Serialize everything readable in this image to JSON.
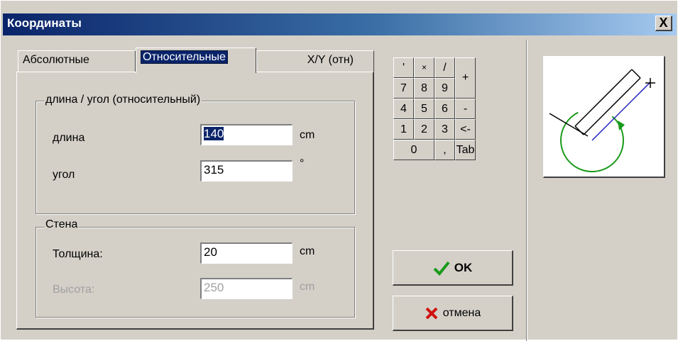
{
  "window": {
    "title": "Координаты",
    "close_label": "X"
  },
  "tabs": [
    {
      "label": "Абсолютные"
    },
    {
      "label": "Относительные"
    },
    {
      "label": "X/Y (отн)"
    }
  ],
  "relative_group": {
    "label": "длина / угол (относительный)",
    "length_label": "длина",
    "length_value": "140",
    "length_unit": "cm",
    "angle_label": "угол",
    "angle_value": "315",
    "angle_unit": "°"
  },
  "wall_group": {
    "label": "Стена",
    "thickness_label": "Толщина:",
    "thickness_value": "20",
    "thickness_unit": "cm",
    "height_label": "Высота:",
    "height_value": "250",
    "height_unit": "cm"
  },
  "keypad": {
    "row0": [
      "'",
      "×",
      "/"
    ],
    "row1": [
      "7",
      "8",
      "9"
    ],
    "row2": [
      "4",
      "5",
      "6"
    ],
    "row3": [
      "1",
      "2",
      "3"
    ],
    "zero": "0",
    "comma": ",",
    "tab": "Tab",
    "plus": "+",
    "minus": "-",
    "back": "<-"
  },
  "buttons": {
    "ok_label": "OK",
    "cancel_label": "отмена"
  },
  "colors": {
    "title_start": "#0a246a",
    "title_end": "#a6caf0",
    "ok_icon": "#1a9a1a",
    "cancel_icon": "#d01010",
    "preview_arc": "#1a9a1a",
    "preview_line": "#2020c0"
  }
}
